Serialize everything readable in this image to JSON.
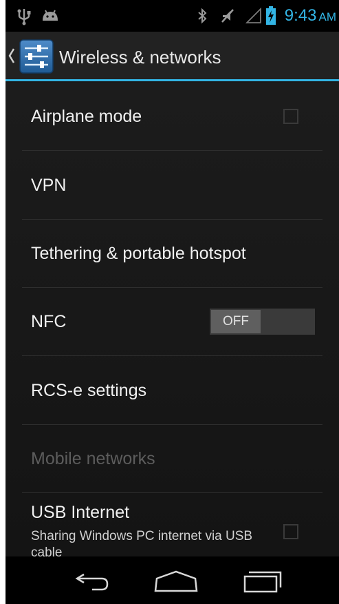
{
  "status_bar": {
    "time": "9:43",
    "ampm": "AM",
    "icons": [
      "usb-icon",
      "android-debug-icon",
      "bluetooth-icon",
      "muted-icon",
      "signal-icon",
      "battery-charging-icon"
    ],
    "accent_color": "#33b5e5"
  },
  "action_bar": {
    "title": "Wireless & networks",
    "icon": "settings-sliders-icon"
  },
  "settings": {
    "airplane_mode": {
      "label": "Airplane mode",
      "checked": false
    },
    "vpn": {
      "label": "VPN"
    },
    "tethering": {
      "label": "Tethering & portable hotspot"
    },
    "nfc": {
      "label": "NFC",
      "toggle_state": "OFF"
    },
    "rcs": {
      "label": "RCS-e settings"
    },
    "mobile_networks": {
      "label": "Mobile networks",
      "enabled": false
    },
    "usb_internet": {
      "label": "USB Internet",
      "summary": "Sharing Windows PC internet via USB cable",
      "checked": false
    }
  },
  "nav_bar": {
    "buttons": [
      "back-icon",
      "home-icon",
      "recents-icon"
    ]
  }
}
